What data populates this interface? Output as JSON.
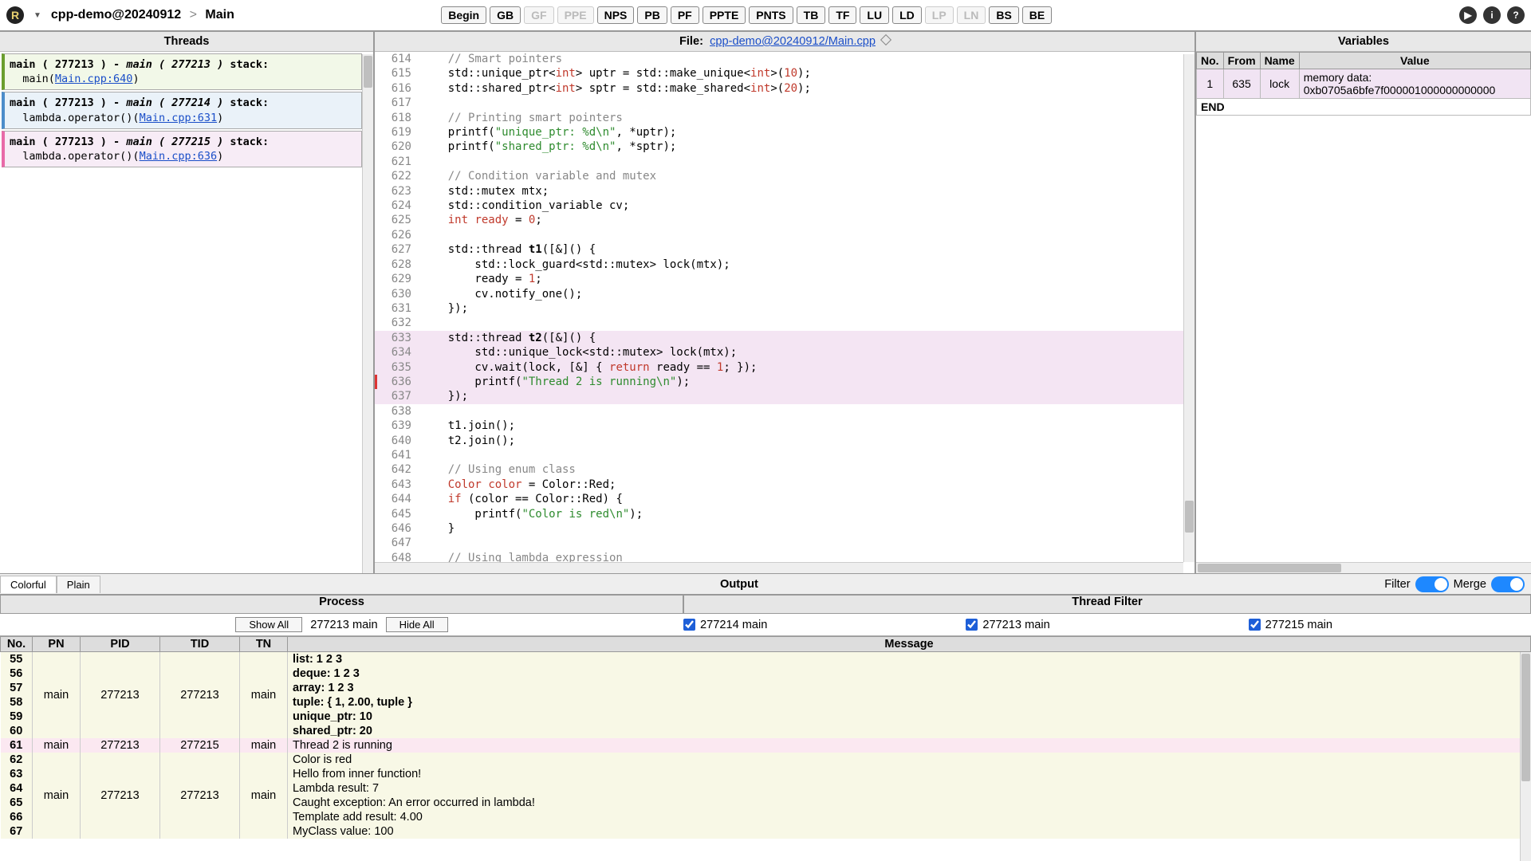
{
  "header": {
    "project": "cpp-demo@20240912",
    "page": "Main",
    "buttons": [
      "Begin",
      "GB",
      "GF",
      "PPE",
      "NPS",
      "PB",
      "PF",
      "PPTE",
      "PNTS",
      "TB",
      "TF",
      "LU",
      "LD",
      "LP",
      "LN",
      "BS",
      "BE"
    ],
    "buttons_disabled": [
      2,
      3,
      13,
      14
    ]
  },
  "threads": {
    "title": "Threads",
    "items": [
      {
        "cls": "tc-green",
        "h1": "main ( 277213 ) - ",
        "h2": "main ( 277213 )",
        "h3": " stack:",
        "line2a": "main(",
        "link": "Main.cpp:640",
        "line2b": ")"
      },
      {
        "cls": "tc-blue",
        "h1": "main ( 277213 ) - ",
        "h2": "main ( 277214 )",
        "h3": " stack:",
        "line2a": "lambda.operator()(",
        "link": "Main.cpp:631",
        "line2b": ")"
      },
      {
        "cls": "tc-pink",
        "h1": "main ( 277213 ) - ",
        "h2": "main ( 277215 )",
        "h3": " stack:",
        "line2a": "lambda.operator()(",
        "link": "Main.cpp:636",
        "line2b": ")"
      }
    ]
  },
  "file": {
    "label": "File:",
    "name": "cpp-demo@20240912/Main.cpp"
  },
  "code": {
    "start": 614,
    "lines": [
      {
        "n": 614,
        "seg": [
          [
            "    ",
            ""
          ],
          [
            "// Smart pointers",
            "cmt"
          ]
        ]
      },
      {
        "n": 615,
        "seg": [
          [
            "    std::unique_ptr<",
            ""
          ],
          [
            "int",
            "type"
          ],
          [
            "> uptr = std::make_unique<",
            ""
          ],
          [
            "int",
            "type"
          ],
          [
            ">(",
            ""
          ],
          [
            "10",
            "num"
          ],
          [
            ");",
            ""
          ]
        ]
      },
      {
        "n": 616,
        "seg": [
          [
            "    std::shared_ptr<",
            ""
          ],
          [
            "int",
            "type"
          ],
          [
            "> sptr = std::make_shared<",
            ""
          ],
          [
            "int",
            "type"
          ],
          [
            ">(",
            ""
          ],
          [
            "20",
            "num"
          ],
          [
            ");",
            ""
          ]
        ]
      },
      {
        "n": 617,
        "seg": [
          [
            "",
            ""
          ]
        ]
      },
      {
        "n": 618,
        "seg": [
          [
            "    ",
            ""
          ],
          [
            "// Printing smart pointers",
            "cmt"
          ]
        ]
      },
      {
        "n": 619,
        "seg": [
          [
            "    printf(",
            ""
          ],
          [
            "\"unique_ptr: %d\\n\"",
            "str"
          ],
          [
            ", *uptr);",
            ""
          ]
        ]
      },
      {
        "n": 620,
        "seg": [
          [
            "    printf(",
            ""
          ],
          [
            "\"shared_ptr: %d\\n\"",
            "str"
          ],
          [
            ", *sptr);",
            ""
          ]
        ]
      },
      {
        "n": 621,
        "seg": [
          [
            "",
            ""
          ]
        ]
      },
      {
        "n": 622,
        "seg": [
          [
            "    ",
            ""
          ],
          [
            "// Condition variable and mutex",
            "cmt"
          ]
        ]
      },
      {
        "n": 623,
        "seg": [
          [
            "    std::mutex mtx;",
            ""
          ]
        ]
      },
      {
        "n": 624,
        "seg": [
          [
            "    std::condition_variable cv;",
            ""
          ]
        ]
      },
      {
        "n": 625,
        "seg": [
          [
            "    ",
            ""
          ],
          [
            "int",
            "type"
          ],
          [
            " ",
            ""
          ],
          [
            "ready",
            "kw"
          ],
          [
            " = ",
            ""
          ],
          [
            "0",
            "num"
          ],
          [
            ";",
            ""
          ]
        ]
      },
      {
        "n": 626,
        "seg": [
          [
            "",
            ""
          ]
        ]
      },
      {
        "n": 627,
        "seg": [
          [
            "    std::thread ",
            ""
          ],
          [
            "t1",
            "fn"
          ],
          [
            "([&]() {",
            ""
          ]
        ]
      },
      {
        "n": 628,
        "seg": [
          [
            "        std::lock_guard<std::mutex> lock(mtx);",
            ""
          ]
        ]
      },
      {
        "n": 629,
        "seg": [
          [
            "        ready = ",
            ""
          ],
          [
            "1",
            "num"
          ],
          [
            ";",
            ""
          ]
        ]
      },
      {
        "n": 630,
        "seg": [
          [
            "        cv.notify_one();",
            ""
          ]
        ]
      },
      {
        "n": 631,
        "seg": [
          [
            "    });",
            ""
          ]
        ]
      },
      {
        "n": 632,
        "seg": [
          [
            "",
            ""
          ]
        ]
      },
      {
        "n": 633,
        "hl": "pink",
        "seg": [
          [
            "    std::thread ",
            ""
          ],
          [
            "t2",
            "fn"
          ],
          [
            "([&]() {",
            ""
          ]
        ]
      },
      {
        "n": 634,
        "hl": "pink",
        "seg": [
          [
            "        std::unique_lock<std::mutex> lock(mtx);",
            ""
          ]
        ]
      },
      {
        "n": 635,
        "hl": "pink",
        "seg": [
          [
            "        cv.wait(lock, [&] { ",
            ""
          ],
          [
            "return",
            "kw"
          ],
          [
            " ready == ",
            ""
          ],
          [
            "1",
            "num"
          ],
          [
            "; });",
            ""
          ]
        ]
      },
      {
        "n": 636,
        "hl": "pink",
        "mark": "red",
        "seg": [
          [
            "        printf(",
            ""
          ],
          [
            "\"Thread 2 is running\\n\"",
            "str"
          ],
          [
            ");",
            ""
          ]
        ]
      },
      {
        "n": 637,
        "hl": "pink",
        "seg": [
          [
            "    });",
            ""
          ]
        ]
      },
      {
        "n": 638,
        "seg": [
          [
            "",
            ""
          ]
        ]
      },
      {
        "n": 639,
        "seg": [
          [
            "    t1.join();",
            ""
          ]
        ]
      },
      {
        "n": 640,
        "seg": [
          [
            "    t2.join();",
            ""
          ]
        ]
      },
      {
        "n": 641,
        "seg": [
          [
            "",
            ""
          ]
        ]
      },
      {
        "n": 642,
        "seg": [
          [
            "    ",
            ""
          ],
          [
            "// Using enum class",
            "cmt"
          ]
        ]
      },
      {
        "n": 643,
        "seg": [
          [
            "    ",
            ""
          ],
          [
            "Color",
            "type"
          ],
          [
            " ",
            ""
          ],
          [
            "color",
            "kw"
          ],
          [
            " = Color::Red;",
            ""
          ]
        ]
      },
      {
        "n": 644,
        "seg": [
          [
            "    ",
            ""
          ],
          [
            "if",
            "kw"
          ],
          [
            " (color == Color::Red) {",
            ""
          ]
        ]
      },
      {
        "n": 645,
        "seg": [
          [
            "        printf(",
            ""
          ],
          [
            "\"Color is red\\n\"",
            "str"
          ],
          [
            ");",
            ""
          ]
        ]
      },
      {
        "n": 646,
        "seg": [
          [
            "    }",
            ""
          ]
        ]
      },
      {
        "n": 647,
        "seg": [
          [
            "",
            ""
          ]
        ]
      },
      {
        "n": 648,
        "seg": [
          [
            "    ",
            ""
          ],
          [
            "// Using lambda expression",
            "cmt"
          ]
        ]
      }
    ]
  },
  "variables": {
    "title": "Variables",
    "cols": [
      "No.",
      "From",
      "Name",
      "Value"
    ],
    "rows": [
      {
        "no": "1",
        "from": "635",
        "name": "lock",
        "value": "memory data: 0xb0705a6bfe7f000001000000000000"
      }
    ],
    "end": "END"
  },
  "output": {
    "tabs": [
      "Colorful",
      "Plain"
    ],
    "title": "Output",
    "filter_label": "Filter",
    "merge_label": "Merge",
    "process_hdr": "Process",
    "threadfilter_hdr": "Thread Filter",
    "show_all": "Show All",
    "hide_all": "Hide All",
    "current": "277213 main",
    "tfilters": [
      "277214 main",
      "277213 main",
      "277215 main"
    ],
    "cols": [
      "No.",
      "PN",
      "PID",
      "TID",
      "TN",
      "Message"
    ],
    "rows": [
      {
        "no": "55",
        "pn": "main",
        "pid": "277213",
        "tid": "277213",
        "tn": "main",
        "msg": "list: 1 2 3",
        "cls": "yel",
        "merge_start": true
      },
      {
        "no": "56",
        "msg": "deque: 1 2 3",
        "cls": "yel"
      },
      {
        "no": "57",
        "msg": "array: 1 2 3",
        "cls": "yel"
      },
      {
        "no": "58",
        "msg": "tuple: { 1, 2.00, tuple }",
        "cls": "yel"
      },
      {
        "no": "59",
        "msg": "unique_ptr: 10",
        "cls": "yel"
      },
      {
        "no": "60",
        "msg": "shared_ptr: 20",
        "cls": "yel"
      },
      {
        "no": "61",
        "pn": "main",
        "pid": "277213",
        "tid": "277215",
        "tn": "main",
        "msg": "Thread 2 is running",
        "cls": "pink"
      },
      {
        "no": "62",
        "pn": "main",
        "pid": "277213",
        "tid": "277213",
        "tn": "main",
        "msg": "Color is red",
        "cls": "yel"
      },
      {
        "no": "63",
        "msg": "Hello from inner function!",
        "cls": "yel"
      },
      {
        "no": "64",
        "msg": "Lambda result: 7",
        "cls": "yel"
      },
      {
        "no": "65",
        "msg": "Caught exception: An error occurred in lambda!",
        "cls": "yel"
      },
      {
        "no": "66",
        "msg": "Template add result: 4.00",
        "cls": "yel"
      },
      {
        "no": "67",
        "msg": "MyClass value: 100",
        "cls": "yel"
      }
    ]
  }
}
